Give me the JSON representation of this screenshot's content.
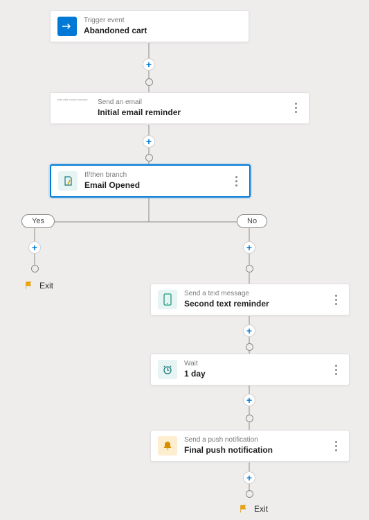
{
  "nodes": {
    "trigger": {
      "type": "Trigger event",
      "title": "Abandoned cart"
    },
    "email": {
      "type": "Send an email",
      "title": "Initial email reminder"
    },
    "branch": {
      "type": "If/then branch",
      "title": "Email Opened"
    },
    "sms": {
      "type": "Send a text message",
      "title": "Second text reminder"
    },
    "wait": {
      "type": "Wait",
      "title": "1 day"
    },
    "push": {
      "type": "Send a push notification",
      "title": "Final push notification"
    }
  },
  "branch": {
    "yes": "Yes",
    "no": "No"
  },
  "exit_label": "Exit"
}
